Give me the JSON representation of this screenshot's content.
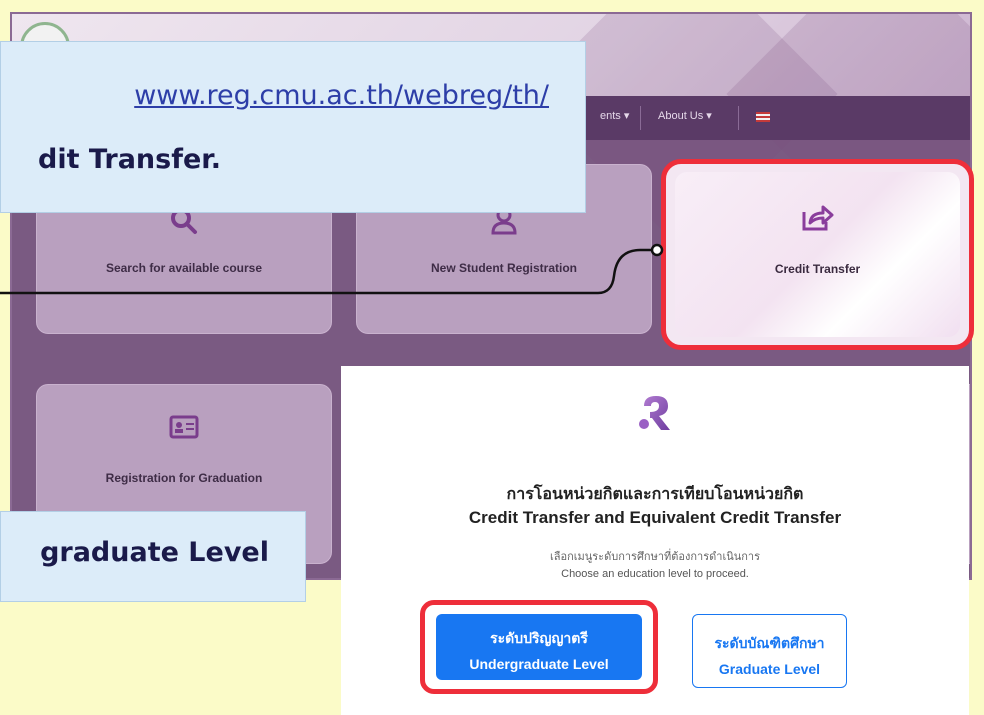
{
  "instructions": {
    "url": "www.reg.cmu.ac.th/webreg/th/",
    "step_text": "dit Transfer.",
    "level_text": "graduate Level"
  },
  "site": {
    "nav": {
      "item_partial": "ents",
      "about": "About Us"
    },
    "cards": {
      "search": "Search for available course",
      "new_student": "New Student Registration",
      "credit_transfer": "Credit Transfer",
      "graduation": "Registration for Graduation"
    }
  },
  "modal": {
    "title_th": "การโอนหน่วยกิตและการเทียบโอนหน่วยกิต",
    "title_en": "Credit Transfer and Equivalent Credit Transfer",
    "subtitle_th": "เลือกเมนูระดับการศึกษาที่ต้องการดำเนินการ",
    "subtitle_en": "Choose an education level to proceed.",
    "undergrad": {
      "th": "ระดับปริญญาตรี",
      "en": "Undergraduate Level"
    },
    "graduate": {
      "th": "ระดับบัณฑิตศึกษา",
      "en": "Graduate Level"
    }
  },
  "colors": {
    "highlight": "#ee2e3a",
    "primary": "#1877f2",
    "background": "#fbfbc8",
    "callout": "#dcecf9"
  }
}
